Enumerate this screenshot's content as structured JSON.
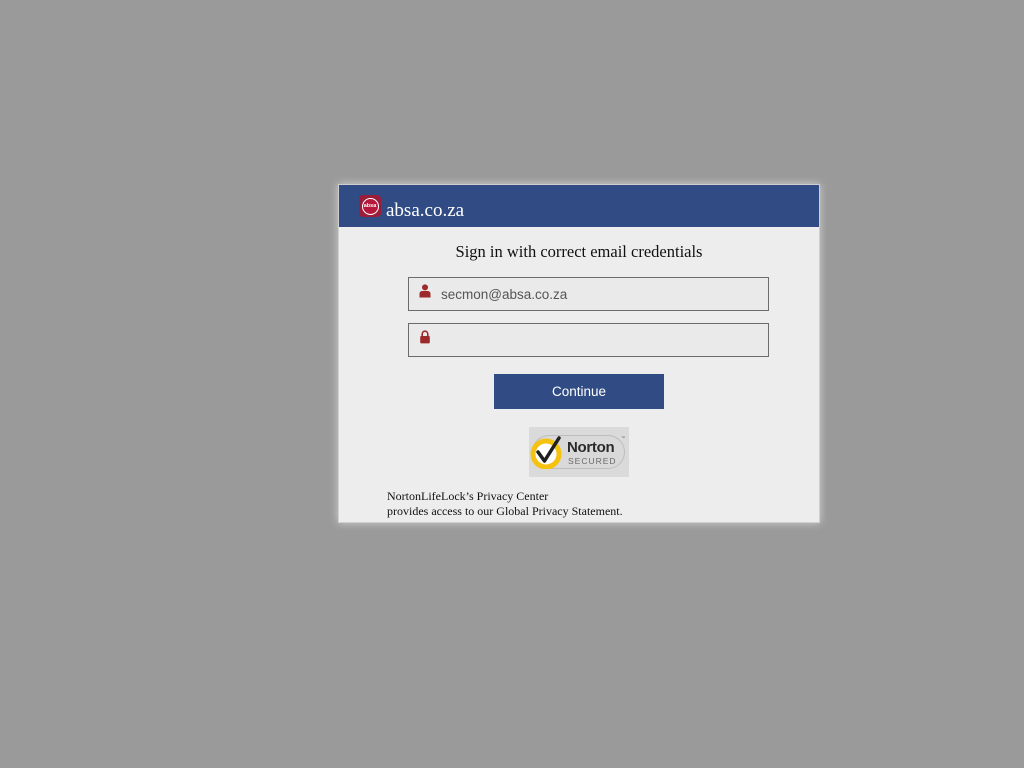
{
  "header": {
    "logo_text": "absa",
    "domain": "absa.co.za"
  },
  "form": {
    "title": "Sign in with correct email credentials",
    "email_value": "secmon@absa.co.za",
    "password_value": "",
    "continue_label": "Continue"
  },
  "badge": {
    "name": "Norton",
    "secured": "SECURED",
    "tm": "™"
  },
  "footer": {
    "line1": "NortonLifeLock’s Privacy Center",
    "line2": "provides access to our Global Privacy Statement."
  },
  "colors": {
    "header_bg": "#314c85",
    "button_bg": "#314c85",
    "icon_red": "#9c2a2a",
    "brand_red": "#9c1d3a",
    "norton_yellow": "#f5c211"
  },
  "icons": {
    "email_icon": "user-icon",
    "password_icon": "lock-icon",
    "badge_icon": "checkmark-icon"
  }
}
